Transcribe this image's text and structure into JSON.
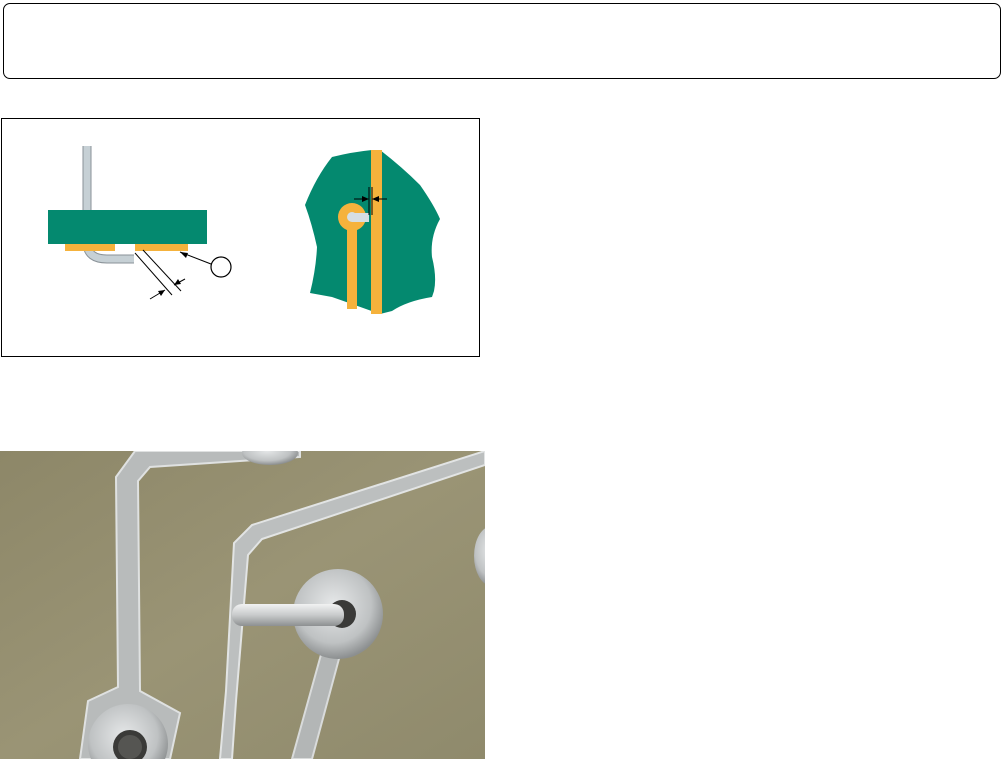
{
  "header": {
    "text": ""
  },
  "diagram": {
    "colors": {
      "board": "#04896f",
      "copper": "#f5b23c",
      "lead": "#c6d0d5",
      "line": "#000000"
    },
    "icons": [
      "circle-callout-icon",
      "dimension-arrow-icon"
    ]
  },
  "photo": {
    "colors": {
      "substrate": "#958e6e",
      "tin": "#c9cbcc",
      "hole": "#3a3a38"
    }
  }
}
